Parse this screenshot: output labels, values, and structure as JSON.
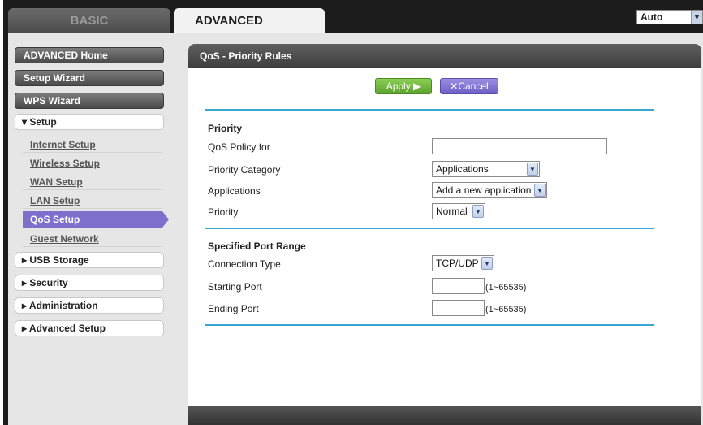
{
  "tabs": {
    "basic": "BASIC",
    "advanced": "ADVANCED"
  },
  "language": {
    "value": "Auto"
  },
  "sidebar": {
    "advanced_home": "ADVANCED Home",
    "setup_wizard": "Setup Wizard",
    "wps_wizard": "WPS Wizard",
    "setup": "▾ Setup",
    "links": [
      "Internet Setup",
      "Wireless Setup",
      "WAN Setup",
      "LAN Setup",
      "QoS Setup",
      "Guest Network"
    ],
    "usb_storage": "▸ USB Storage",
    "security": "▸ Security",
    "administration": "▸ Administration",
    "advanced_setup": "▸ Advanced Setup"
  },
  "panel": {
    "title": "QoS - Priority Rules",
    "apply_label": "Apply ▶",
    "cancel_label": "✕Cancel",
    "priority_section": "Priority",
    "qos_policy_label": "QoS Policy for",
    "qos_policy_value": "",
    "priority_category_label": "Priority Category",
    "priority_category_value": "Applications",
    "applications_label": "Applications",
    "applications_value": "Add a new application",
    "priority_label": "Priority",
    "priority_value": "Normal",
    "port_section": "Specified Port Range",
    "connection_type_label": "Connection Type",
    "connection_type_value": "TCP/UDP",
    "starting_port_label": "Starting Port",
    "starting_port_value": "",
    "starting_port_hint": "(1~65535)",
    "ending_port_label": "Ending Port",
    "ending_port_value": "",
    "ending_port_hint": "(1~65535)"
  },
  "colors": {
    "accent_blue": "#35a7d0",
    "apply_green": "#6cb43a",
    "cancel_purple": "#7e6fcc",
    "active_nav": "#7e6fcc"
  }
}
